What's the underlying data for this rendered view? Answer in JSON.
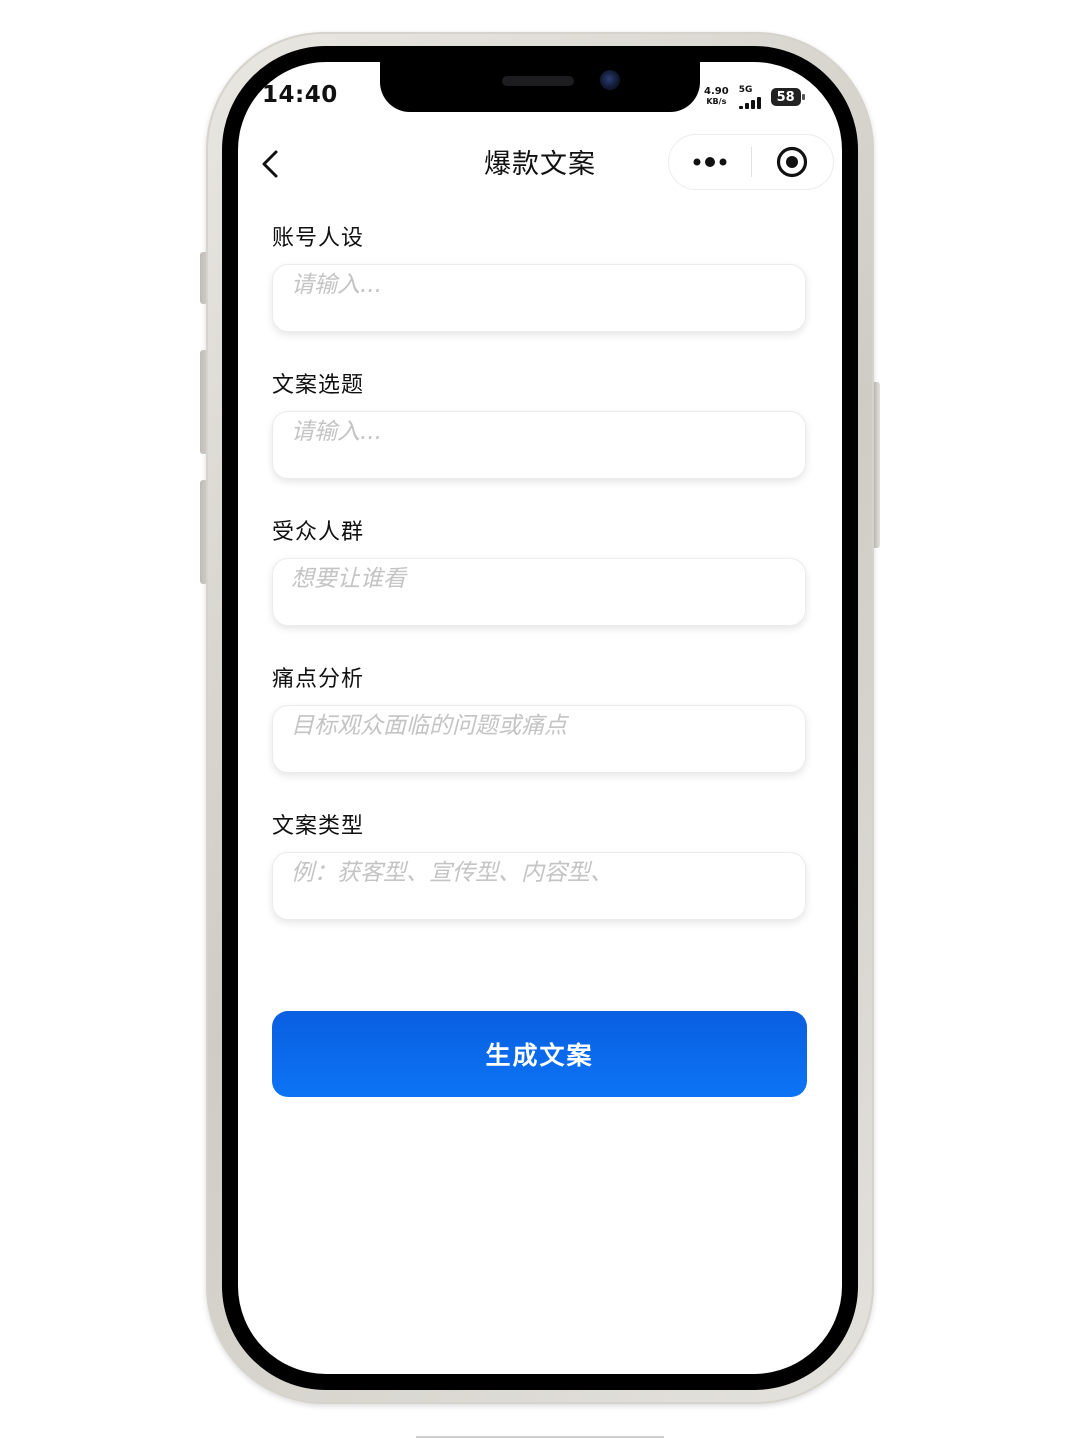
{
  "status_bar": {
    "time": "14:40",
    "net_speed_value": "4.90",
    "net_speed_unit": "KB/s",
    "network_type": "5G",
    "battery": "58"
  },
  "nav": {
    "title": "爆款文案",
    "back_icon": "chevron-left-icon",
    "more_icon": "more-dots-icon",
    "close_icon": "target-circle-icon"
  },
  "form": {
    "fields": [
      {
        "label": "账号人设",
        "placeholder": "请输入..."
      },
      {
        "label": "文案选题",
        "placeholder": "请输入..."
      },
      {
        "label": "受众人群",
        "placeholder": "想要让谁看"
      },
      {
        "label": "痛点分析",
        "placeholder": "目标观众面临的问题或痛点"
      },
      {
        "label": "文案类型",
        "placeholder": "例：获客型、宣传型、内容型、"
      }
    ],
    "submit_label": "生成文案"
  },
  "colors": {
    "primary": "#0b6cf0",
    "placeholder": "#c4c4c4",
    "text": "#111111"
  }
}
